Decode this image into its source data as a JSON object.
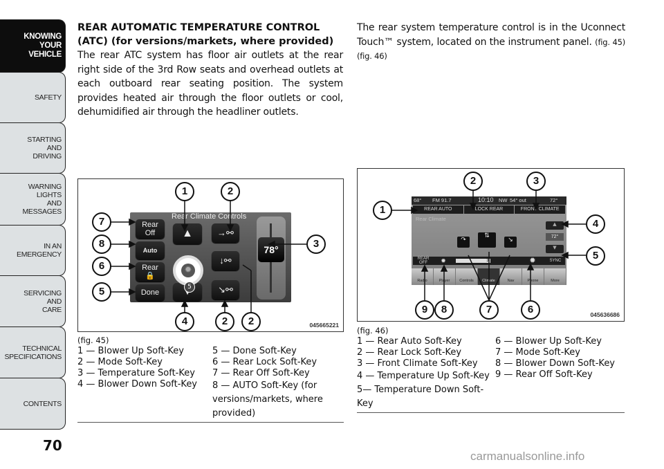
{
  "sidebar": {
    "tabs": [
      {
        "lines": [
          "KNOWING",
          "YOUR",
          "VEHICLE"
        ],
        "active": true
      },
      {
        "lines": [
          "SAFETY"
        ],
        "active": false
      },
      {
        "lines": [
          "STARTING",
          "AND",
          "DRIVING"
        ],
        "active": false
      },
      {
        "lines": [
          "WARNING",
          "LIGHTS",
          "AND",
          "MESSAGES"
        ],
        "active": false
      },
      {
        "lines": [
          "IN AN",
          "EMERGENCY"
        ],
        "active": false
      },
      {
        "lines": [
          "SERVICING",
          "AND",
          "CARE"
        ],
        "active": false
      },
      {
        "lines": [
          "TECHNICAL",
          "SPECIFICATIONS"
        ],
        "active": false
      },
      {
        "lines": [
          "CONTENTS"
        ],
        "active": false
      }
    ],
    "page_number": "70"
  },
  "left_column": {
    "heading": "REAR AUTOMATIC TEMPERATURE CONTROL (ATC) (for versions/markets, where provided)",
    "body": "The rear ATC system has floor air outlets at the rear right side of the 3rd Row seats and overhead outlets at each outboard rear seating position. The system provides heated air through the floor outlets or cool, dehumidified air through the headliner outlets."
  },
  "right_column": {
    "body": "The rear system temperature control is in the Uconnect Touch™ system, located on the instrument panel.",
    "refs": "(fig. 45) (fig. 46)"
  },
  "fig45": {
    "code": "045665221",
    "screen_title": "Rear Climate Controls",
    "buttons": {
      "rear_off": [
        "Rear",
        "Off"
      ],
      "auto": "Auto",
      "rear_lock": "Rear",
      "done": "Done",
      "temperature": "78°",
      "fan_level": "5"
    },
    "callouts": [
      "1",
      "2",
      "7",
      "8",
      "3",
      "6",
      "5",
      "4",
      "2",
      "2"
    ],
    "caption": {
      "ref": "(fig. 45)",
      "left": [
        "1 — Blower Up Soft-Key",
        "2 — Mode Soft-Key",
        "3 — Temperature Soft-Key",
        "4 — Blower Down Soft-Key"
      ],
      "right": [
        "5 — Done Soft-Key",
        "6 — Rear Lock Soft-Key",
        "7 — Rear Off Soft-Key",
        "8 — AUTO Soft-Key (for versions/markets, where provided)"
      ]
    }
  },
  "fig46": {
    "code": "045636686",
    "status": {
      "temp_left": "68°",
      "radio": "FM 91.7",
      "time": "10:10",
      "compass": "NW",
      "outside": "54° out",
      "temp_right": "72°"
    },
    "top_buttons": [
      "REAR AUTO",
      "LOCK REAR",
      "FRONT CLIMATE"
    ],
    "screen_label": "Rear Climate",
    "temperature": "72°",
    "fan_bar": {
      "rear_off": "REAR OFF",
      "level": "3",
      "sync": "SYNC"
    },
    "nav": [
      "Radio",
      "Player",
      "Controls",
      "Climate",
      "Nav",
      "Phone",
      "More"
    ],
    "callouts": [
      "2",
      "3",
      "1",
      "4",
      "5",
      "9",
      "8",
      "7",
      "6"
    ],
    "caption": {
      "ref": "(fig. 46)",
      "left": [
        "1 — Rear Auto Soft-Key",
        "2 — Rear Lock Soft-Key",
        "3 — Front Climate Soft-Key",
        "4 — Temperature Up Soft-Key",
        "5— Temperature Down Soft-Key"
      ],
      "right": [
        "6 — Blower Up Soft-Key",
        "7 — Mode Soft-Key",
        "8 — Blower Down Soft-Key",
        "9 — Rear Off Soft-Key"
      ]
    }
  },
  "watermark": "carmanualsonline.info"
}
